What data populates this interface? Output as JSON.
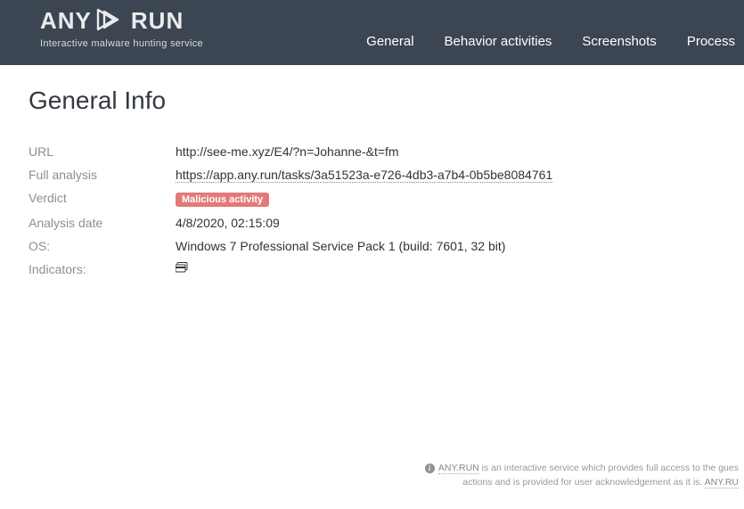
{
  "brand": {
    "any": "ANY",
    "run": "RUN",
    "tagline": "Interactive malware hunting service"
  },
  "nav": {
    "general": "General",
    "behavior": "Behavior activities",
    "screenshots": "Screenshots",
    "process": "Process"
  },
  "page": {
    "title": "General Info"
  },
  "info": {
    "url_label": "URL",
    "url_value": "http://see-me.xyz/E4/?n=Johanne-&t=fm",
    "full_label": "Full analysis",
    "full_value": "https://app.any.run/tasks/3a51523a-e726-4db3-a7b4-0b5be8084761",
    "verdict_label": "Verdict",
    "verdict_badge": "Malicious activity",
    "date_label": "Analysis date",
    "date_value": "4/8/2020, 02:15:09",
    "os_label": "OS:",
    "os_value": "Windows 7 Professional Service Pack 1 (build: 7601, 32 bit)",
    "indicators_label": "Indicators:"
  },
  "footer": {
    "brand1": "ANY.RUN",
    "text1": " is an interactive service which provides full access to the gues",
    "text2": "actions and is provided for user acknowledgement as it is. ",
    "brand2": "ANY.RU"
  }
}
